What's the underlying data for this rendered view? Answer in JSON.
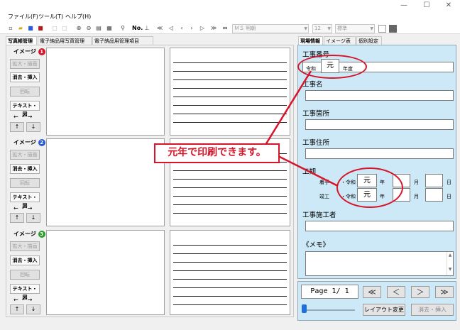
{
  "window": {
    "minimize": "—",
    "maximize": "☐",
    "close": "✕"
  },
  "menu": [
    "ファイル(F)",
    "ツール(T)",
    "ヘルプ(H)"
  ],
  "toolbar": {
    "number_label": "No.",
    "font_name": "ＭＳ 明朝",
    "font_size": "12",
    "style": "標準"
  },
  "left_tabs": [
    "写真帳管理",
    "電子納品用写真管理",
    "電子納品用管理項目"
  ],
  "images": [
    {
      "title": "イメージ",
      "badge": "1",
      "badge_color": "#d7152a"
    },
    {
      "title": "イメージ",
      "badge": "2",
      "badge_color": "#2a5bd7"
    },
    {
      "title": "イメージ",
      "badge": "3",
      "badge_color": "#2a9d2a"
    }
  ],
  "side_buttons": {
    "enlarge": "拡大・描画",
    "delete_insert": "消去・挿入",
    "rotate": "回転",
    "text_figure": "テキスト・図",
    "lr": "← ・ →",
    "up": "↑",
    "down": "↓"
  },
  "right_tabs": [
    "現場情報",
    "イメージ表示",
    "個別設定"
  ],
  "panel": {
    "work_number_label": "工事番号",
    "era_label": "令和",
    "era_year": "元",
    "fiscal_year_label": "年度",
    "work_name_label": "工事名",
    "work_location_label": "工事箇所",
    "work_address_label": "工事住所",
    "period_label": "工期",
    "start_label": "着手",
    "finish_label": "竣工",
    "dash_era": "・令和",
    "year_unit": "年",
    "month_unit": "月",
    "day_unit": "日",
    "start_year": "元",
    "finish_year": "元",
    "contractor_label": "工事施工者",
    "memo_label": "《メモ》"
  },
  "callout": "元年で印刷できます。",
  "nav": {
    "page": "Page  1/ 1",
    "first": "≪",
    "prev": "＜",
    "next": "＞",
    "last": "≫",
    "layout_change": "レイアウト変更",
    "delete_insert": "消去・挿入"
  }
}
